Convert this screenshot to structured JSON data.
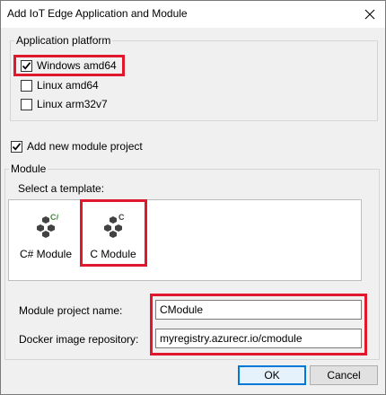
{
  "window": {
    "title": "Add IoT Edge Application and Module",
    "close_glyph": "×"
  },
  "platform": {
    "legend": "Application platform",
    "options": [
      {
        "label": "Windows amd64",
        "checked": true
      },
      {
        "label": "Linux amd64",
        "checked": false
      },
      {
        "label": "Linux arm32v7",
        "checked": false
      }
    ]
  },
  "add_module": {
    "label": "Add new module project",
    "checked": true
  },
  "module": {
    "legend": "Module",
    "template_prompt": "Select a template:",
    "templates": [
      {
        "label": "C# Module",
        "badge": "C#",
        "icon": "csharp-module-icon"
      },
      {
        "label": "C Module",
        "badge": "C",
        "icon": "c-module-icon"
      }
    ],
    "project_name_label": "Module project name:",
    "project_name_value": "CModule",
    "repo_label": "Docker image repository:",
    "repo_value": "myregistry.azurecr.io/cmodule"
  },
  "buttons": {
    "ok": "OK",
    "cancel": "Cancel"
  },
  "colors": {
    "highlight": "#e0172d",
    "icon_gray": "#424242",
    "badge_green": "#388a34",
    "accent": "#0078d7"
  }
}
